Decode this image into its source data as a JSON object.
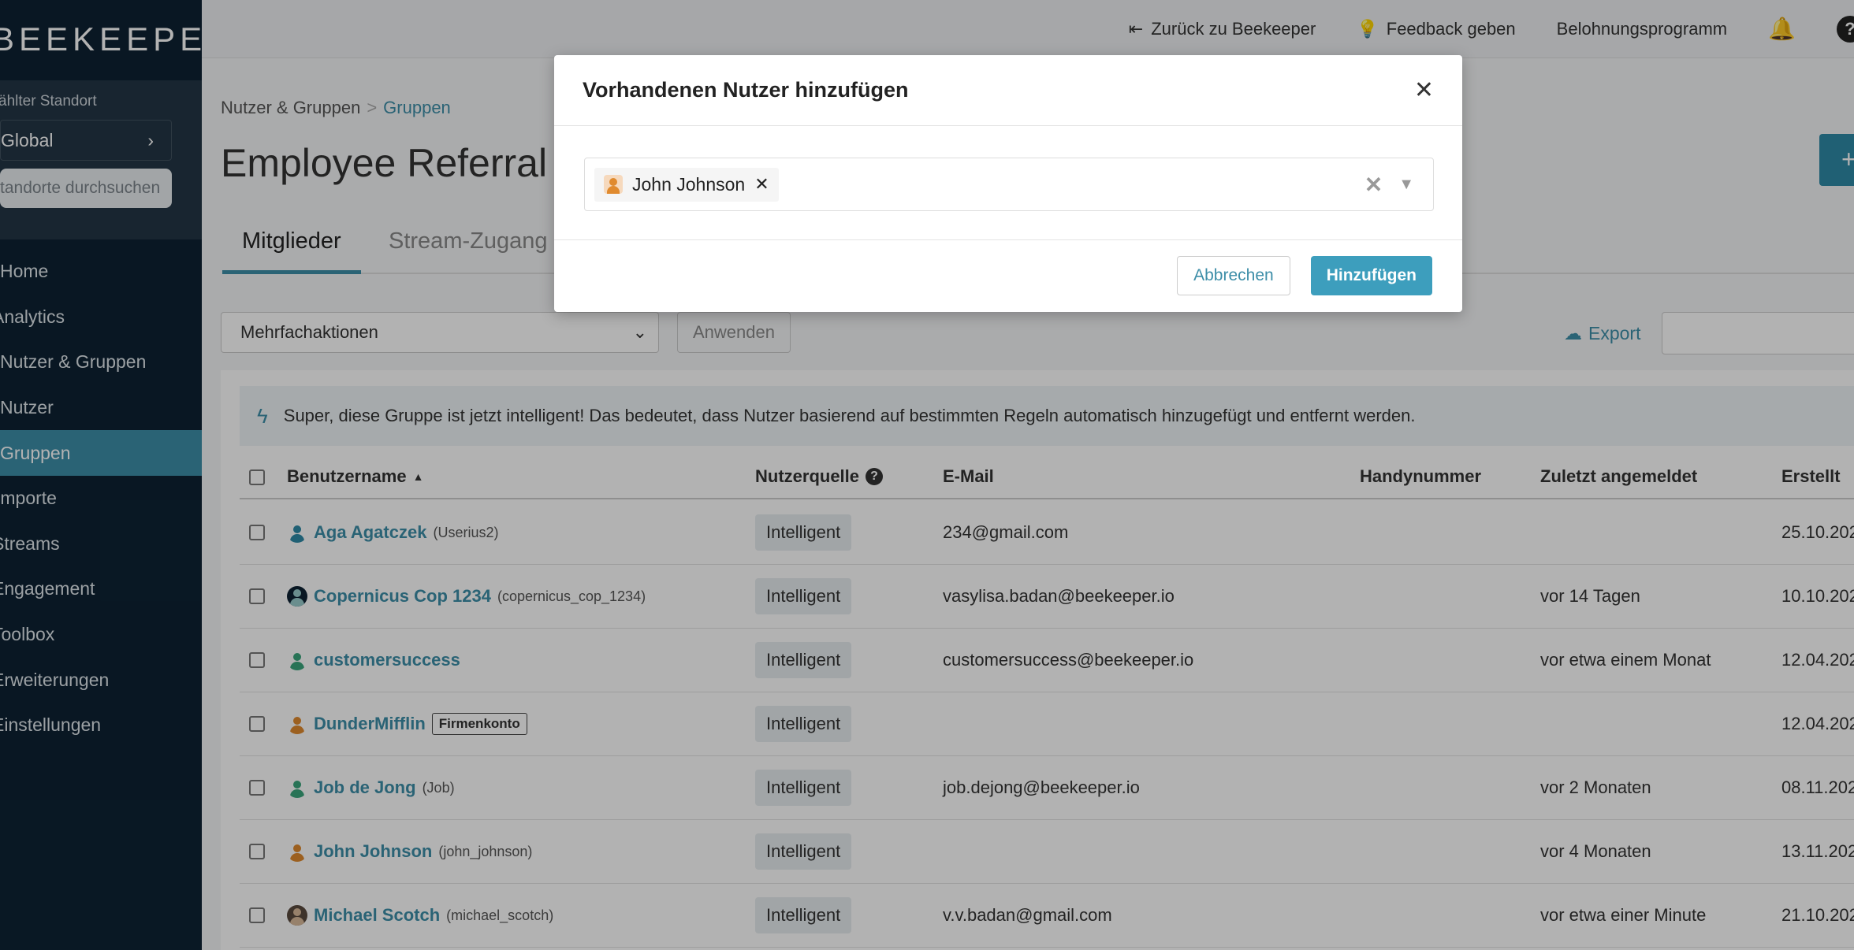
{
  "sidebar": {
    "logo": "BEEKEEPER",
    "location_label": "ählter Standort",
    "location_value": "Global",
    "location_search_placeholder": "tandorte durchsuchen",
    "nav": [
      "Home",
      "Analytics",
      "Nutzer & Gruppen",
      "Nutzer",
      "Gruppen",
      "Importe",
      "Streams",
      "Engagement",
      "Toolbox",
      "Erweiterungen",
      "Einstellungen"
    ],
    "nav_display": [
      "Home",
      "Analytics",
      "Nutzer & Gruppen",
      "Nutzer",
      "Gruppen",
      "Importe",
      "Streams",
      "Engagement",
      "Toolbox",
      "Erweiterungen",
      "Einstellungen"
    ],
    "active_index": 4
  },
  "topbar": {
    "back": "Zurück zu Beekeeper",
    "feedback": "Feedback geben",
    "rewards": "Belohnungsprogramm"
  },
  "breadcrumb": {
    "parent": "Nutzer & Gruppen",
    "current": "Gruppen"
  },
  "page_title": "Employee Referral Pi",
  "tabs": [
    "Mitglieder",
    "Stream-Zugang"
  ],
  "toolbar": {
    "bulk_actions": "Mehrfachaktionen",
    "apply": "Anwenden",
    "export": "Export"
  },
  "info_text": "Super, diese Gruppe ist jetzt intelligent! Das bedeutet, dass Nutzer basierend auf bestimmten Regeln automatisch hinzugefügt und entfernt werden.",
  "table": {
    "headers": {
      "username": "Benutzername",
      "source": "Nutzerquelle",
      "email": "E-Mail",
      "phone": "Handynummer",
      "last_login": "Zuletzt angemeldet",
      "created": "Erstellt"
    },
    "rows": [
      {
        "name": "Aga Agatczek",
        "handle": "(Userius2)",
        "tag": "",
        "source": "Intelligent",
        "email": "234@gmail.com",
        "phone": "",
        "last_login": "",
        "created": "25.10.202"
      },
      {
        "name": "Copernicus Cop 1234",
        "handle": "(copernicus_cop_1234)",
        "tag": "",
        "source": "Intelligent",
        "email": "vasylisa.badan@beekeeper.io",
        "phone": "",
        "last_login": "vor 14 Tagen",
        "created": "10.10.202"
      },
      {
        "name": "customersuccess",
        "handle": "",
        "tag": "",
        "source": "Intelligent",
        "email": "customersuccess@beekeeper.io",
        "phone": "",
        "last_login": "vor etwa einem Monat",
        "created": "12.04.202"
      },
      {
        "name": "DunderMifflin",
        "handle": "",
        "tag": "Firmenkonto",
        "source": "Intelligent",
        "email": "",
        "phone": "",
        "last_login": "",
        "created": "12.04.202"
      },
      {
        "name": "Job de Jong",
        "handle": "(Job)",
        "tag": "",
        "source": "Intelligent",
        "email": "job.dejong@beekeeper.io",
        "phone": "",
        "last_login": "vor 2 Monaten",
        "created": "08.11.202"
      },
      {
        "name": "John Johnson",
        "handle": "(john_johnson)",
        "tag": "",
        "source": "Intelligent",
        "email": "",
        "phone": "",
        "last_login": "vor 4 Monaten",
        "created": "13.11.202"
      },
      {
        "name": "Michael Scotch",
        "handle": "(michael_scotch)",
        "tag": "",
        "source": "Intelligent",
        "email": "v.v.badan@gmail.com",
        "phone": "",
        "last_login": "vor etwa einer Minute",
        "created": "21.10.202"
      }
    ]
  },
  "modal": {
    "title": "Vorhandenen Nutzer hinzufügen",
    "selected_user": "John Johnson",
    "cancel": "Abbrechen",
    "add": "Hinzufügen"
  }
}
